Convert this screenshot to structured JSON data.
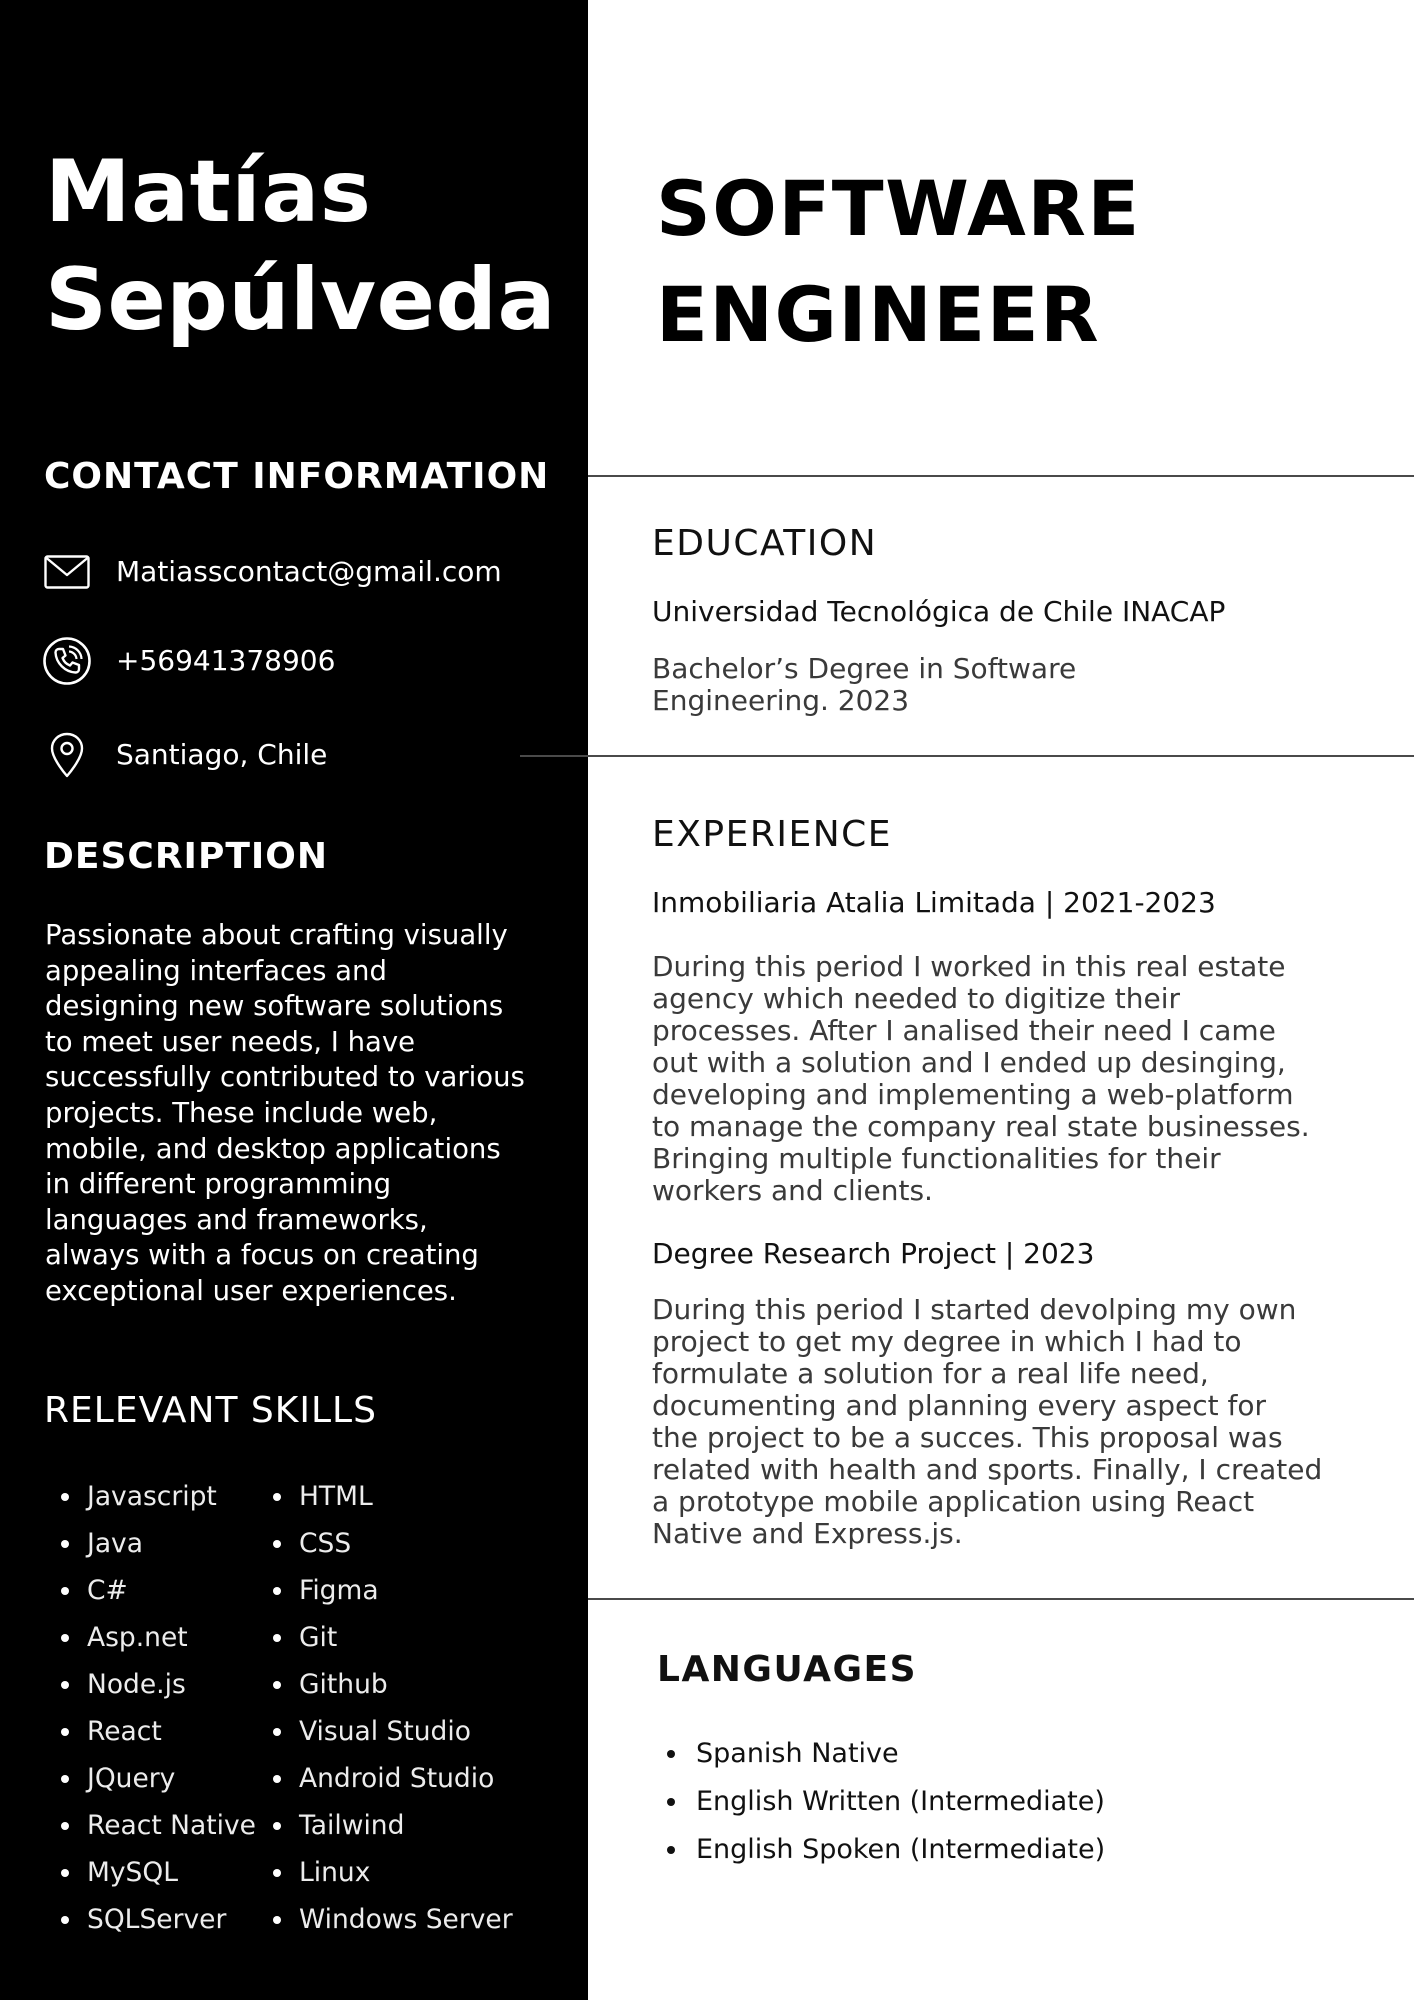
{
  "name": {
    "first": "Matías",
    "last": "Sepúlveda"
  },
  "role": {
    "line1": "SOFTWARE",
    "line2": "ENGINEER"
  },
  "contact": {
    "heading": "CONTACT INFORMATION",
    "email": "Matiasscontact@gmail.com",
    "phone": "+56941378906",
    "location": "Santiago, Chile",
    "icons": {
      "email": "envelope-icon",
      "phone": "phone-icon",
      "location": "map-pin-icon"
    }
  },
  "description": {
    "heading": "DESCRIPTION",
    "text": "Passionate about crafting visually appealing interfaces and designing new software solutions to meet user needs, I have successfully contributed to various projects. These include web, mobile, and desktop applications in different programming languages and frameworks, always with a focus on creating exceptional user experiences."
  },
  "skills": {
    "heading": "RELEVANT SKILLS",
    "column1": [
      "Javascript",
      "Java",
      "C#",
      "Asp.net",
      "Node.js",
      "React",
      "JQuery",
      "React Native",
      "MySQL",
      "SQLServer"
    ],
    "column2": [
      "HTML",
      "CSS",
      "Figma",
      "Git",
      "Github",
      "Visual Studio",
      "Android Studio",
      "Tailwind",
      "Linux",
      "Windows Server"
    ]
  },
  "education": {
    "heading": "EDUCATION",
    "institution": "Universidad Tecnológica de Chile INACAP",
    "degree_line1": "Bachelor’s Degree in Software",
    "degree_line2": "Engineering. 2023"
  },
  "experience": {
    "heading": "EXPERIENCE",
    "jobs": [
      {
        "title": "Inmobiliaria Atalia Limitada | 2021-2023",
        "lines": [
          "During this period I worked in this real estate",
          "agency which needed to digitize their",
          "processes. After I analised their need I came",
          "out with a solution and I ended up desinging,",
          "developing and implementing a web-platform",
          "to manage the company real state businesses.",
          "Bringing multiple functionalities for their",
          "workers and clients."
        ]
      },
      {
        "title": "Degree Research Project | 2023",
        "lines": [
          "During this period I started devolping my own",
          "project to get my degree in which I had to",
          "formulate a solution for a real life need,",
          "documenting and planning every aspect for",
          "the project to be a succes. This proposal was",
          "related with health and sports. Finally, I created",
          "a prototype mobile application using React",
          "Native and Express.js."
        ]
      }
    ]
  },
  "languages": {
    "heading": "LANGUAGES",
    "items": [
      "Spanish Native",
      "English Written (Intermediate)",
      "English Spoken (Intermediate)"
    ]
  },
  "colors": {
    "sidebar": "#000000",
    "page": "#ffffff",
    "divider": "#4a4a4a"
  }
}
